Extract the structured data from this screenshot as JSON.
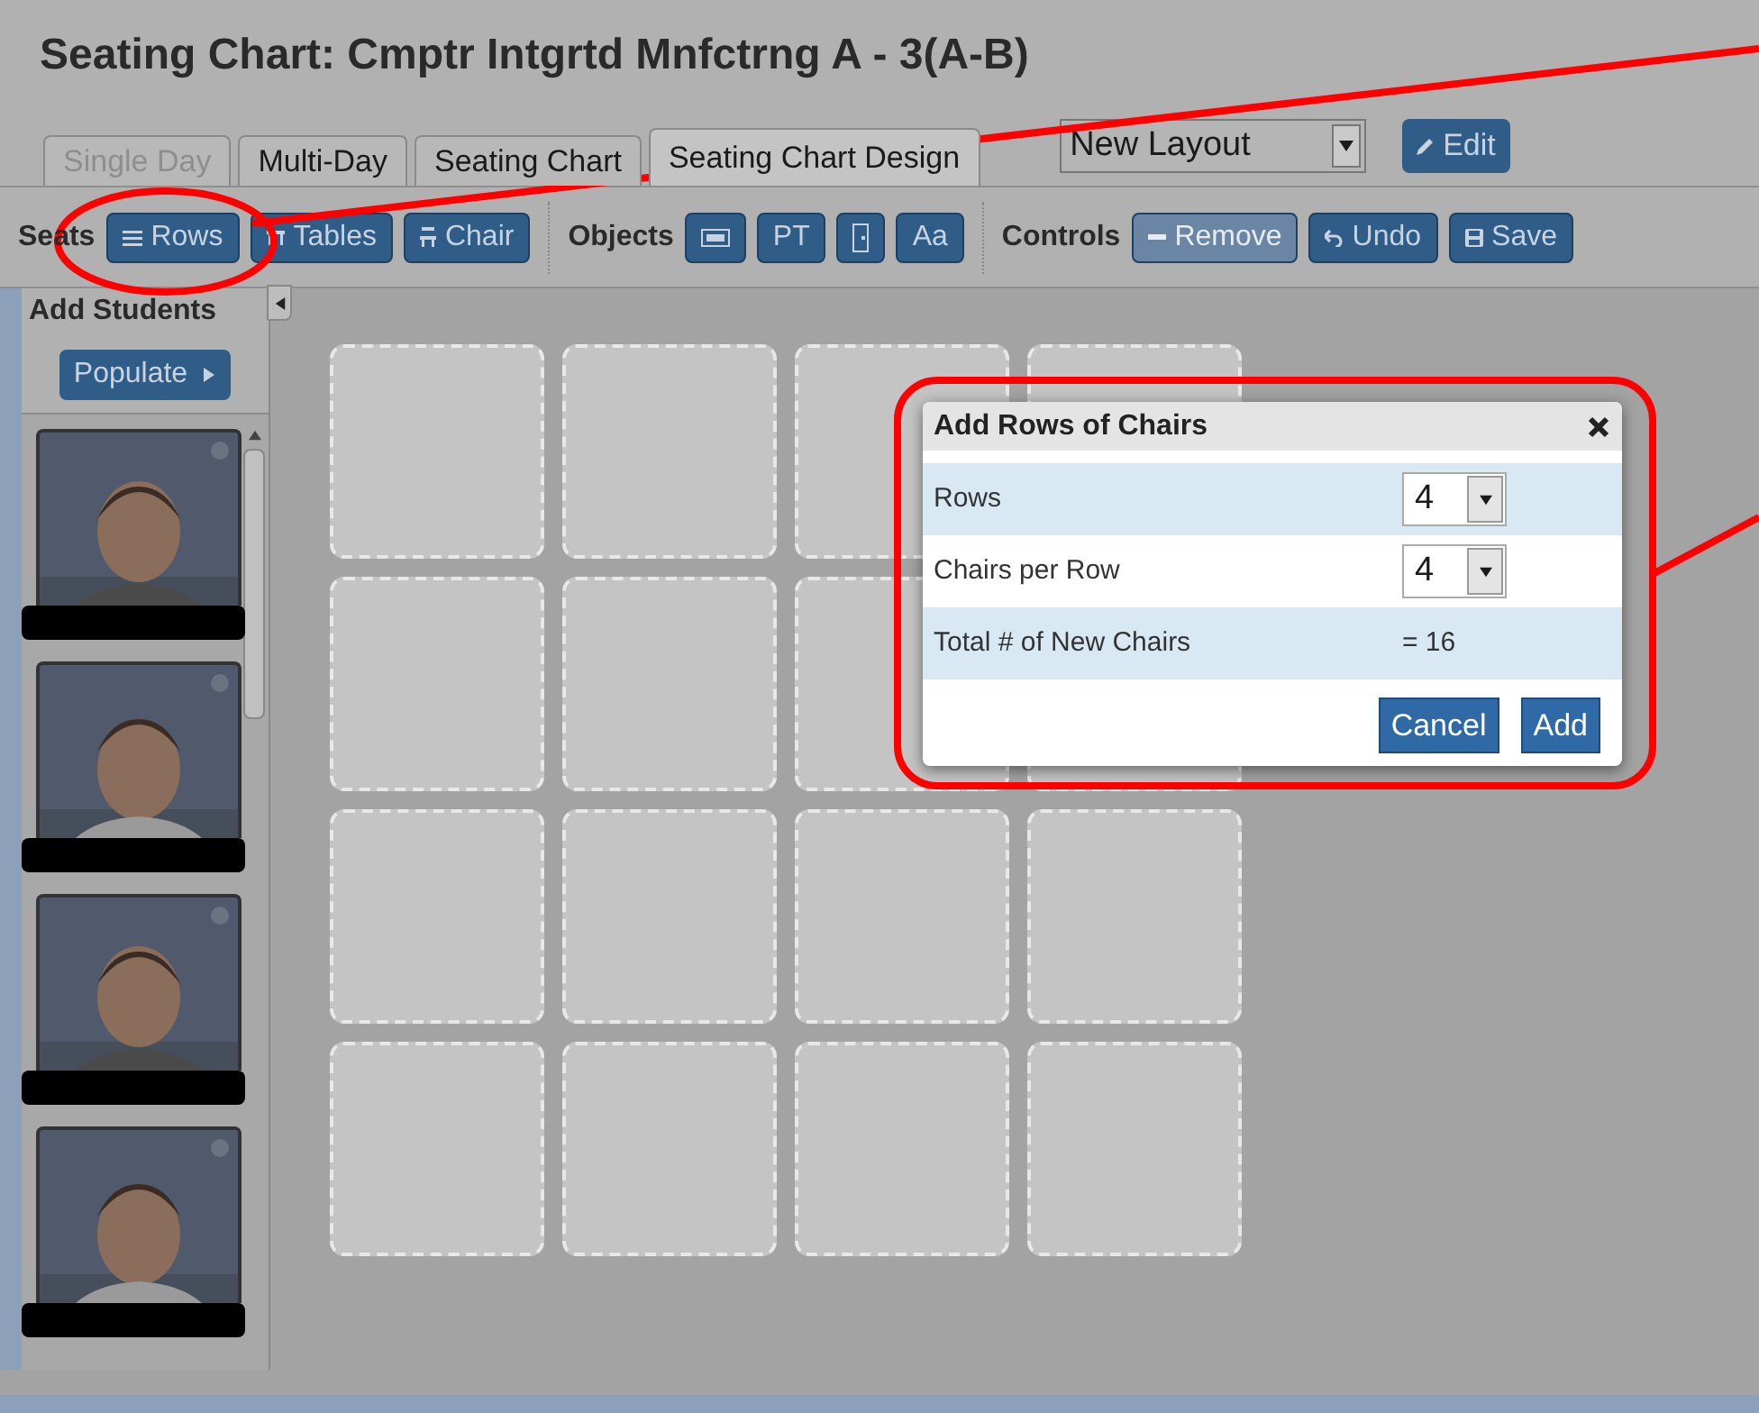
{
  "title": "Seating Chart: Cmptr Intgrtd Mnfctrng A - 3(A-B)",
  "tabs": [
    {
      "label": "Single Day",
      "selected": false,
      "disabled": true
    },
    {
      "label": "Multi-Day",
      "selected": false,
      "disabled": false
    },
    {
      "label": "Seating Chart",
      "selected": false,
      "disabled": false
    },
    {
      "label": "Seating Chart Design",
      "selected": true,
      "disabled": false
    }
  ],
  "layout_select": {
    "value": "New Layout"
  },
  "edit_button": "Edit",
  "toolbar": [
    {
      "label": "Seats",
      "buttons": [
        {
          "kind": "rows",
          "label": "Rows",
          "disabled": false
        },
        {
          "kind": "tables",
          "label": "Tables",
          "disabled": false
        },
        {
          "kind": "chair",
          "label": "Chair",
          "disabled": false
        }
      ]
    },
    {
      "label": "Objects",
      "buttons": [
        {
          "kind": "board",
          "disabled": false
        },
        {
          "kind": "text",
          "label": "PT",
          "disabled": false
        },
        {
          "kind": "door",
          "disabled": false
        },
        {
          "kind": "text",
          "label": "Aa",
          "disabled": false
        }
      ]
    },
    {
      "label": "Controls",
      "buttons": [
        {
          "kind": "remove",
          "label": "Remove",
          "disabled": true
        },
        {
          "kind": "undo",
          "label": "Undo",
          "disabled": false
        },
        {
          "kind": "save",
          "label": "Save",
          "disabled": false
        }
      ]
    }
  ],
  "sidebar": {
    "title": "Add Students",
    "populate_button": "Populate"
  },
  "dialog": {
    "title": "Add Rows of Chairs",
    "rows": [
      {
        "kind": "select",
        "label": "Rows",
        "value": "4"
      },
      {
        "kind": "select",
        "label": "Chairs per Row",
        "value": "4"
      },
      {
        "kind": "text",
        "label": "Total # of New Chairs",
        "value": "= 16"
      }
    ],
    "buttons": [
      "Cancel",
      "Add"
    ]
  }
}
